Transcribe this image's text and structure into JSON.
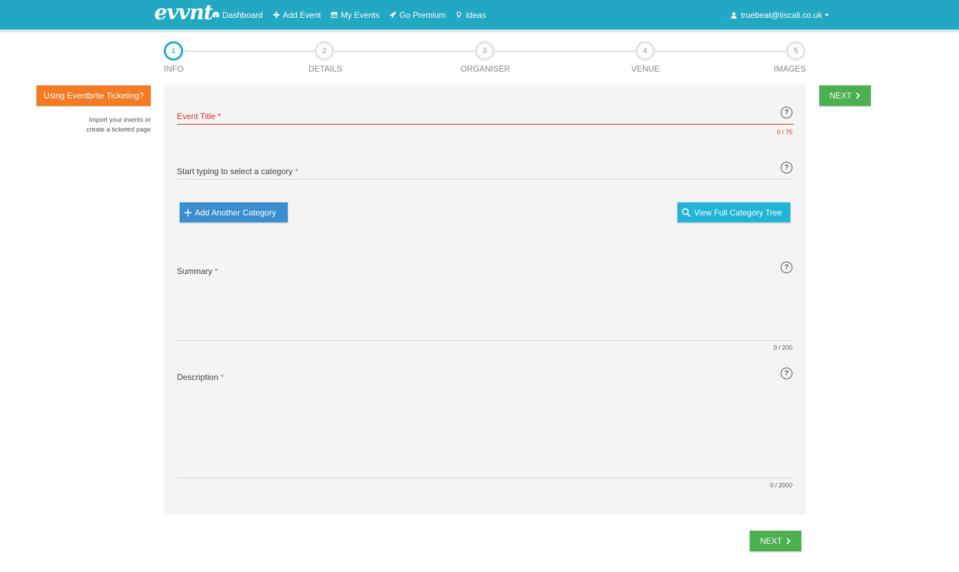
{
  "header": {
    "logo": "evvnt",
    "nav": [
      {
        "label": "Dashboard",
        "icon": "dashboard-icon"
      },
      {
        "label": "Add Event",
        "icon": "plus-icon"
      },
      {
        "label": "My Events",
        "icon": "calendar-icon"
      },
      {
        "label": "Go Premium",
        "icon": "rocket-icon"
      },
      {
        "label": "Ideas",
        "icon": "lightbulb-icon"
      }
    ],
    "user": "truebeat@tiscali.co.uk"
  },
  "stepper": {
    "steps": [
      {
        "number": "1",
        "label": "INFO",
        "active": true
      },
      {
        "number": "2",
        "label": "DETAILS",
        "active": false
      },
      {
        "number": "3",
        "label": "ORGANISER",
        "active": false
      },
      {
        "number": "4",
        "label": "VENUE",
        "active": false
      },
      {
        "number": "5",
        "label": "IMAGES",
        "active": false
      }
    ]
  },
  "sidebar": {
    "eventbrite_button": "Using Eventbrite Ticketing?",
    "note_line1": "Import your events or",
    "note_line2": "create a ticketed page"
  },
  "form": {
    "title": {
      "label": "Event Title",
      "required": "*",
      "counter": "0 / 75"
    },
    "category": {
      "label": "Start typing to select a category",
      "required": "*"
    },
    "add_category": "Add Another Category",
    "view_tree": "View Full Category Tree",
    "summary": {
      "label": "Summary",
      "required": "*",
      "counter": "0 / 200"
    },
    "description": {
      "label": "Description",
      "required": "*",
      "counter": "0 / 2000"
    },
    "help_glyph": "?"
  },
  "actions": {
    "next": "NEXT"
  },
  "colors": {
    "brand": "#23a8c4",
    "orange": "#f37c22",
    "green": "#4caf50",
    "error": "#d32f2f"
  }
}
